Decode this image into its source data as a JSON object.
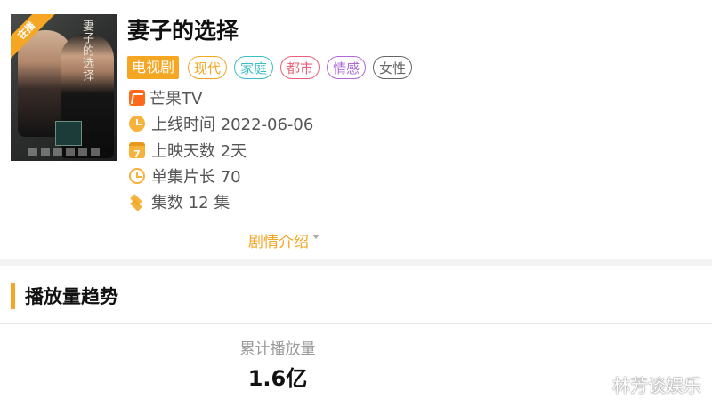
{
  "poster": {
    "ribbon": "在播",
    "artwork_title": "妻子的选择"
  },
  "drama": {
    "title": "妻子的选择",
    "type_tag": "电视剧",
    "tags": [
      {
        "label": "现代",
        "color": "#f5a623"
      },
      {
        "label": "家庭",
        "color": "#3bbfc7"
      },
      {
        "label": "都市",
        "color": "#e8607a"
      },
      {
        "label": "情感",
        "color": "#b06ad6"
      },
      {
        "label": "女性",
        "color": "#666666"
      }
    ],
    "platform": "芒果TV",
    "release": "上线时间 2022-06-06",
    "days": "上映天数 2天",
    "calendar_icon_text": "7",
    "episode_length": "单集片长 70",
    "episodes": "集数 12 集"
  },
  "plot_toggle": "剧情介绍",
  "trend": {
    "section_title": "播放量趋势",
    "stat_label": "累计播放量",
    "stat_value": "1.6亿"
  },
  "watermark": "林芳谈娱乐",
  "colors": {
    "accent": "#f5a623"
  }
}
